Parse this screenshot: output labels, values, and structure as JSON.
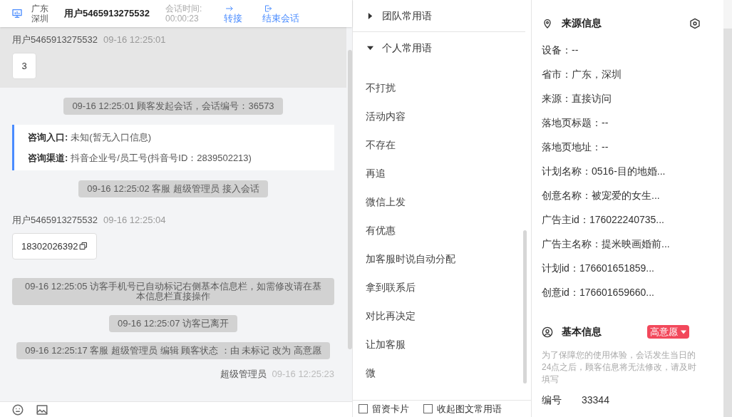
{
  "header": {
    "location": "广东深圳",
    "customer": "用户5465913275532",
    "duration_label": "会话时间:",
    "duration": "00:00:23",
    "actions": [
      {
        "label": "转接",
        "kind": "transfer"
      },
      {
        "label": "结束会话",
        "kind": "end"
      }
    ]
  },
  "messages": [
    {
      "kind": "user",
      "sender": "用户5465913275532",
      "time": "09-16 12:25:01",
      "content": "3",
      "highlighted": true,
      "copyable": false
    },
    {
      "kind": "system",
      "text": "09-16 12:25:01 顾客发起会话，会话编号：36573"
    },
    {
      "kind": "entry",
      "rows": [
        {
          "label": "咨询入口:",
          "value": "未知(暂无入口信息)"
        },
        {
          "label": "咨询渠道:",
          "value": "抖音企业号/员工号(抖音号ID：2839502213)"
        }
      ]
    },
    {
      "kind": "system",
      "text": "09-16 12:25:02 客服 超级管理员 接入会话"
    },
    {
      "kind": "user",
      "sender": "用户5465913275532",
      "time": "09-16 12:25:04",
      "content": "18302026392",
      "highlighted": false,
      "copyable": true
    },
    {
      "kind": "system",
      "text": "09-16 12:25:05 访客手机号已自动标记右侧基本信息栏，如需修改请在基本信息栏直接操作"
    },
    {
      "kind": "system",
      "text": "09-16 12:25:07 访客已离开"
    },
    {
      "kind": "system",
      "text": "09-16 12:25:17 客服 超级管理员 编辑 顾客状态 ：由 未标记 改为 高意愿"
    },
    {
      "kind": "agent",
      "sender": "超级管理员",
      "time": "09-16 12:25:23"
    }
  ],
  "phrases": {
    "groups": [
      {
        "label": "团队常用语",
        "expanded": false
      },
      {
        "label": "个人常用语",
        "expanded": true,
        "items": [
          "不打扰",
          "活动内容",
          "不存在",
          "再追",
          "微信上发",
          "有优惠",
          "加客服时说自动分配",
          "拿到联系后",
          "对比再决定",
          "让加客服",
          "微"
        ]
      }
    ],
    "options": [
      {
        "label": "留资卡片",
        "checked": false
      },
      {
        "label": "收起图文常用语",
        "checked": false
      }
    ]
  },
  "source_info": {
    "title": "来源信息",
    "rows": [
      "设备：--",
      "省市：广东，深圳",
      "来源：直接访问",
      "落地页标题：--",
      "落地页地址：--",
      "计划名称：0516-目的地婚...",
      "创意名称：被宠爱的女生...",
      "广告主id：176022240735...",
      "广告主名称：提米映画婚前...",
      "计划id：176601651859...",
      "创意id：176601659660..."
    ]
  },
  "basic_info": {
    "title": "基本信息",
    "status": "高意愿",
    "note": "为了保障您的使用体验，会话发生当日的24点之后，顾客信息将无法修改，请及时填写",
    "fields": [
      {
        "label": "编号",
        "value": "33344"
      }
    ]
  }
}
